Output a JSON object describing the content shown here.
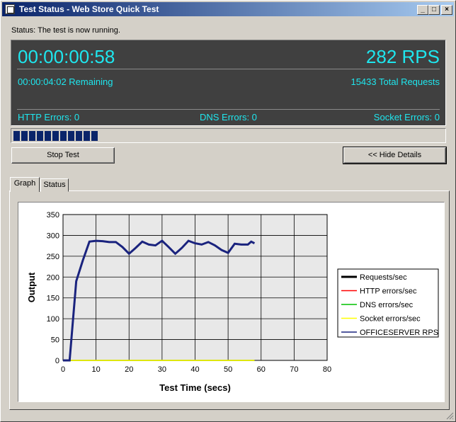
{
  "window": {
    "title": "Test Status - Web Store Quick Test",
    "controls": [
      "_",
      "□",
      "×"
    ]
  },
  "status": {
    "text": "Status: The test is now running."
  },
  "metrics": {
    "elapsed": "00:00:00:58",
    "rps": "282 RPS",
    "remaining": "00:00:04:02 Remaining",
    "total_requests": "15433 Total Requests",
    "http_errors": "HTTP Errors: 0",
    "dns_errors": "DNS Errors: 0",
    "socket_errors": "Socket Errors: 0",
    "color": "#1ee6ee"
  },
  "progress": {
    "fraction": 0.2
  },
  "buttons": {
    "stop": "Stop Test",
    "hide_details": "<< Hide Details"
  },
  "tabs": [
    {
      "label": "Graph",
      "active": true
    },
    {
      "label": "Status",
      "active": false
    }
  ],
  "chart_data": {
    "type": "line",
    "xlabel": "Test Time (secs)",
    "ylabel": "Output",
    "xlim": [
      0,
      80
    ],
    "ylim": [
      0,
      350
    ],
    "xticks": [
      0,
      10,
      20,
      30,
      40,
      50,
      60,
      70,
      80
    ],
    "yticks": [
      0,
      50,
      100,
      150,
      200,
      250,
      300,
      350
    ],
    "grid": true,
    "legend_position": "right",
    "series": [
      {
        "name": "Requests/sec",
        "color": "#000000",
        "x": [
          0,
          2,
          4,
          6,
          8,
          10,
          12,
          14,
          16,
          18,
          20,
          22,
          24,
          26,
          28,
          30,
          32,
          34,
          36,
          38,
          40,
          42,
          44,
          46,
          48,
          50,
          52,
          54,
          56,
          57,
          58
        ],
        "y": [
          0,
          0,
          0,
          0,
          0,
          0,
          0,
          0,
          0,
          0,
          0,
          0,
          0,
          0,
          0,
          0,
          0,
          0,
          0,
          0,
          0,
          0,
          0,
          0,
          0,
          0,
          0,
          0,
          0,
          0,
          0
        ]
      },
      {
        "name": "HTTP errors/sec",
        "color": "#ff0000",
        "x": [
          0,
          58
        ],
        "y": [
          0,
          0
        ]
      },
      {
        "name": "DNS errors/sec",
        "color": "#00c000",
        "x": [
          0,
          58
        ],
        "y": [
          0,
          0
        ]
      },
      {
        "name": "Socket errors/sec",
        "color": "#ffff00",
        "x": [
          0,
          58
        ],
        "y": [
          0,
          0
        ]
      },
      {
        "name": "OFFICESERVER RPS",
        "color": "#1a237e",
        "x": [
          0,
          2,
          4,
          6,
          8,
          10,
          12,
          14,
          16,
          18,
          20,
          22,
          24,
          26,
          28,
          30,
          32,
          34,
          36,
          38,
          40,
          42,
          44,
          46,
          48,
          50,
          52,
          54,
          56,
          57,
          58
        ],
        "y": [
          0,
          0,
          190,
          240,
          285,
          287,
          286,
          284,
          284,
          272,
          256,
          270,
          285,
          278,
          276,
          287,
          272,
          256,
          270,
          287,
          281,
          278,
          284,
          276,
          265,
          258,
          280,
          278,
          278,
          285,
          281
        ]
      }
    ]
  }
}
